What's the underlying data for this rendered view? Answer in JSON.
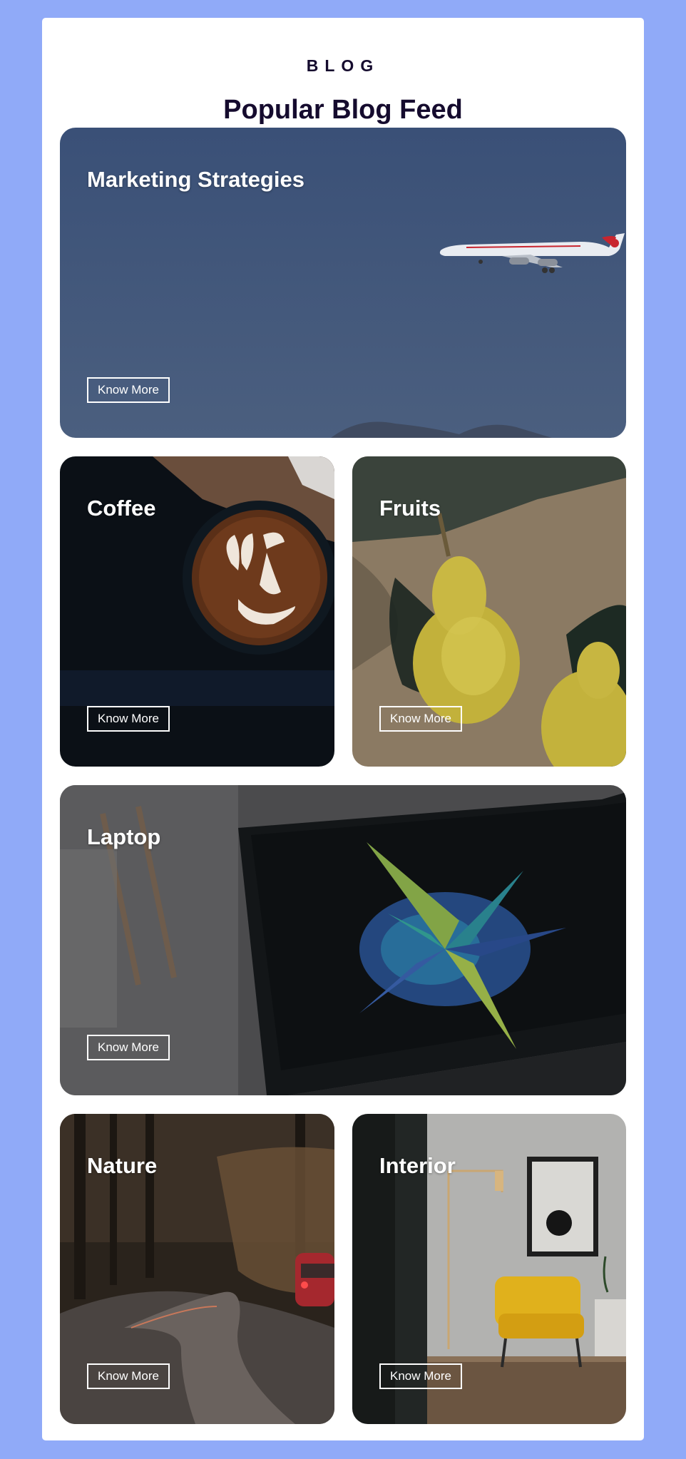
{
  "header": {
    "eyebrow": "BLOG",
    "title": "Popular Blog Feed"
  },
  "cards": [
    {
      "title": "Marketing Strategies",
      "button": "Know More",
      "image": "airplane-in-sky"
    },
    {
      "title": "Coffee",
      "button": "Know More",
      "image": "latte-art-cup"
    },
    {
      "title": "Fruits",
      "button": "Know More",
      "image": "yellow-pears-on-cloth"
    },
    {
      "title": "Laptop",
      "button": "Know More",
      "image": "laptop-color-splash"
    },
    {
      "title": "Nature",
      "button": "Know More",
      "image": "forest-road-car"
    },
    {
      "title": "Interior",
      "button": "Know More",
      "image": "yellow-armchair-room"
    }
  ],
  "colors": {
    "page_background": "#90aaf8",
    "panel_background": "#ffffff",
    "heading_text": "#150b2e",
    "card_text": "#ffffff"
  }
}
